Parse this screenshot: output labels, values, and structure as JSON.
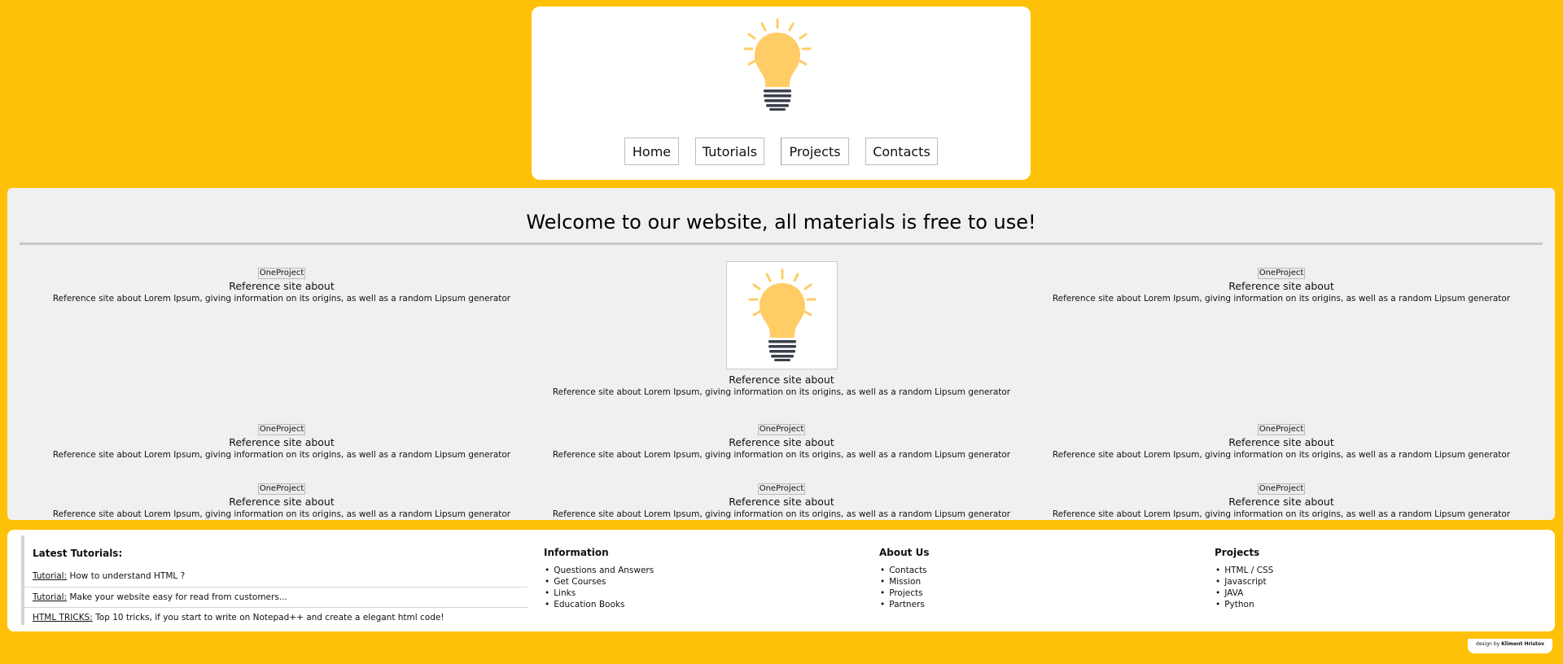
{
  "nav": {
    "items": [
      {
        "label": "Home"
      },
      {
        "label": "Tutorials"
      },
      {
        "label": "Projects"
      },
      {
        "label": "Contacts"
      }
    ]
  },
  "main": {
    "welcome": "Welcome to our website, all materials is free to use!",
    "cells": [
      {
        "tag": "OneProject",
        "title": "Reference site about",
        "desc": "Reference site about Lorem Ipsum, giving information on its origins, as well as a random Lipsum generator"
      },
      {
        "title": "Reference site about",
        "desc": "Reference site about Lorem Ipsum, giving information on its origins, as well as a random Lipsum generator"
      },
      {
        "tag": "OneProject",
        "title": "Reference site about",
        "desc": "Reference site about Lorem Ipsum, giving information on its origins, as well as a random Lipsum generator"
      },
      {
        "tag": "OneProject",
        "title": "Reference site about",
        "desc": "Reference site about Lorem Ipsum, giving information on its origins, as well as a random Lipsum generator"
      },
      {
        "tag": "OneProject",
        "title": "Reference site about",
        "desc": "Reference site about Lorem Ipsum, giving information on its origins, as well as a random Lipsum generator"
      },
      {
        "tag": "OneProject",
        "title": "Reference site about",
        "desc": "Reference site about Lorem Ipsum, giving information on its origins, as well as a random Lipsum generator"
      },
      {
        "tag": "OneProject",
        "title": "Reference site about",
        "desc": "Reference site about Lorem Ipsum, giving information on its origins, as well as a random Lipsum generator"
      },
      {
        "tag": "OneProject",
        "title": "Reference site about",
        "desc": "Reference site about Lorem Ipsum, giving information on its origins, as well as a random Lipsum generator"
      },
      {
        "tag": "OneProject",
        "title": "Reference site about",
        "desc": "Reference site about Lorem Ipsum, giving information on its origins, as well as a random Lipsum generator"
      }
    ]
  },
  "footer": {
    "tutorials": {
      "heading": "Latest Tutorials:",
      "items": [
        {
          "link": "Tutorial:",
          "text": " How to understand HTML ?"
        },
        {
          "link": "Tutorial:",
          "text": " Make your website easy for read from customers..."
        },
        {
          "link": "HTML TRICKS:",
          "text": " Top 10 tricks, if you start to write on Notepad++ and create a elegant html code!"
        }
      ]
    },
    "information": {
      "heading": "Information",
      "items": [
        "Questions and Answers",
        "Get Courses",
        "Links",
        "Education Books"
      ]
    },
    "about": {
      "heading": "About Us",
      "items": [
        "Contacts",
        "Mission",
        "Projects",
        "Partners"
      ]
    },
    "projects": {
      "heading": "Projects",
      "items": [
        "HTML / CSS",
        "Javascript",
        "JAVA",
        "Python"
      ]
    }
  },
  "credit": {
    "prefix": "design by ",
    "author": "Kliment Hristov"
  },
  "colors": {
    "background": "#FFC107",
    "bulb": "#FFCC66",
    "bulb_base": "#3A3F4B"
  },
  "icons": {
    "logo": "lightbulb-icon"
  }
}
